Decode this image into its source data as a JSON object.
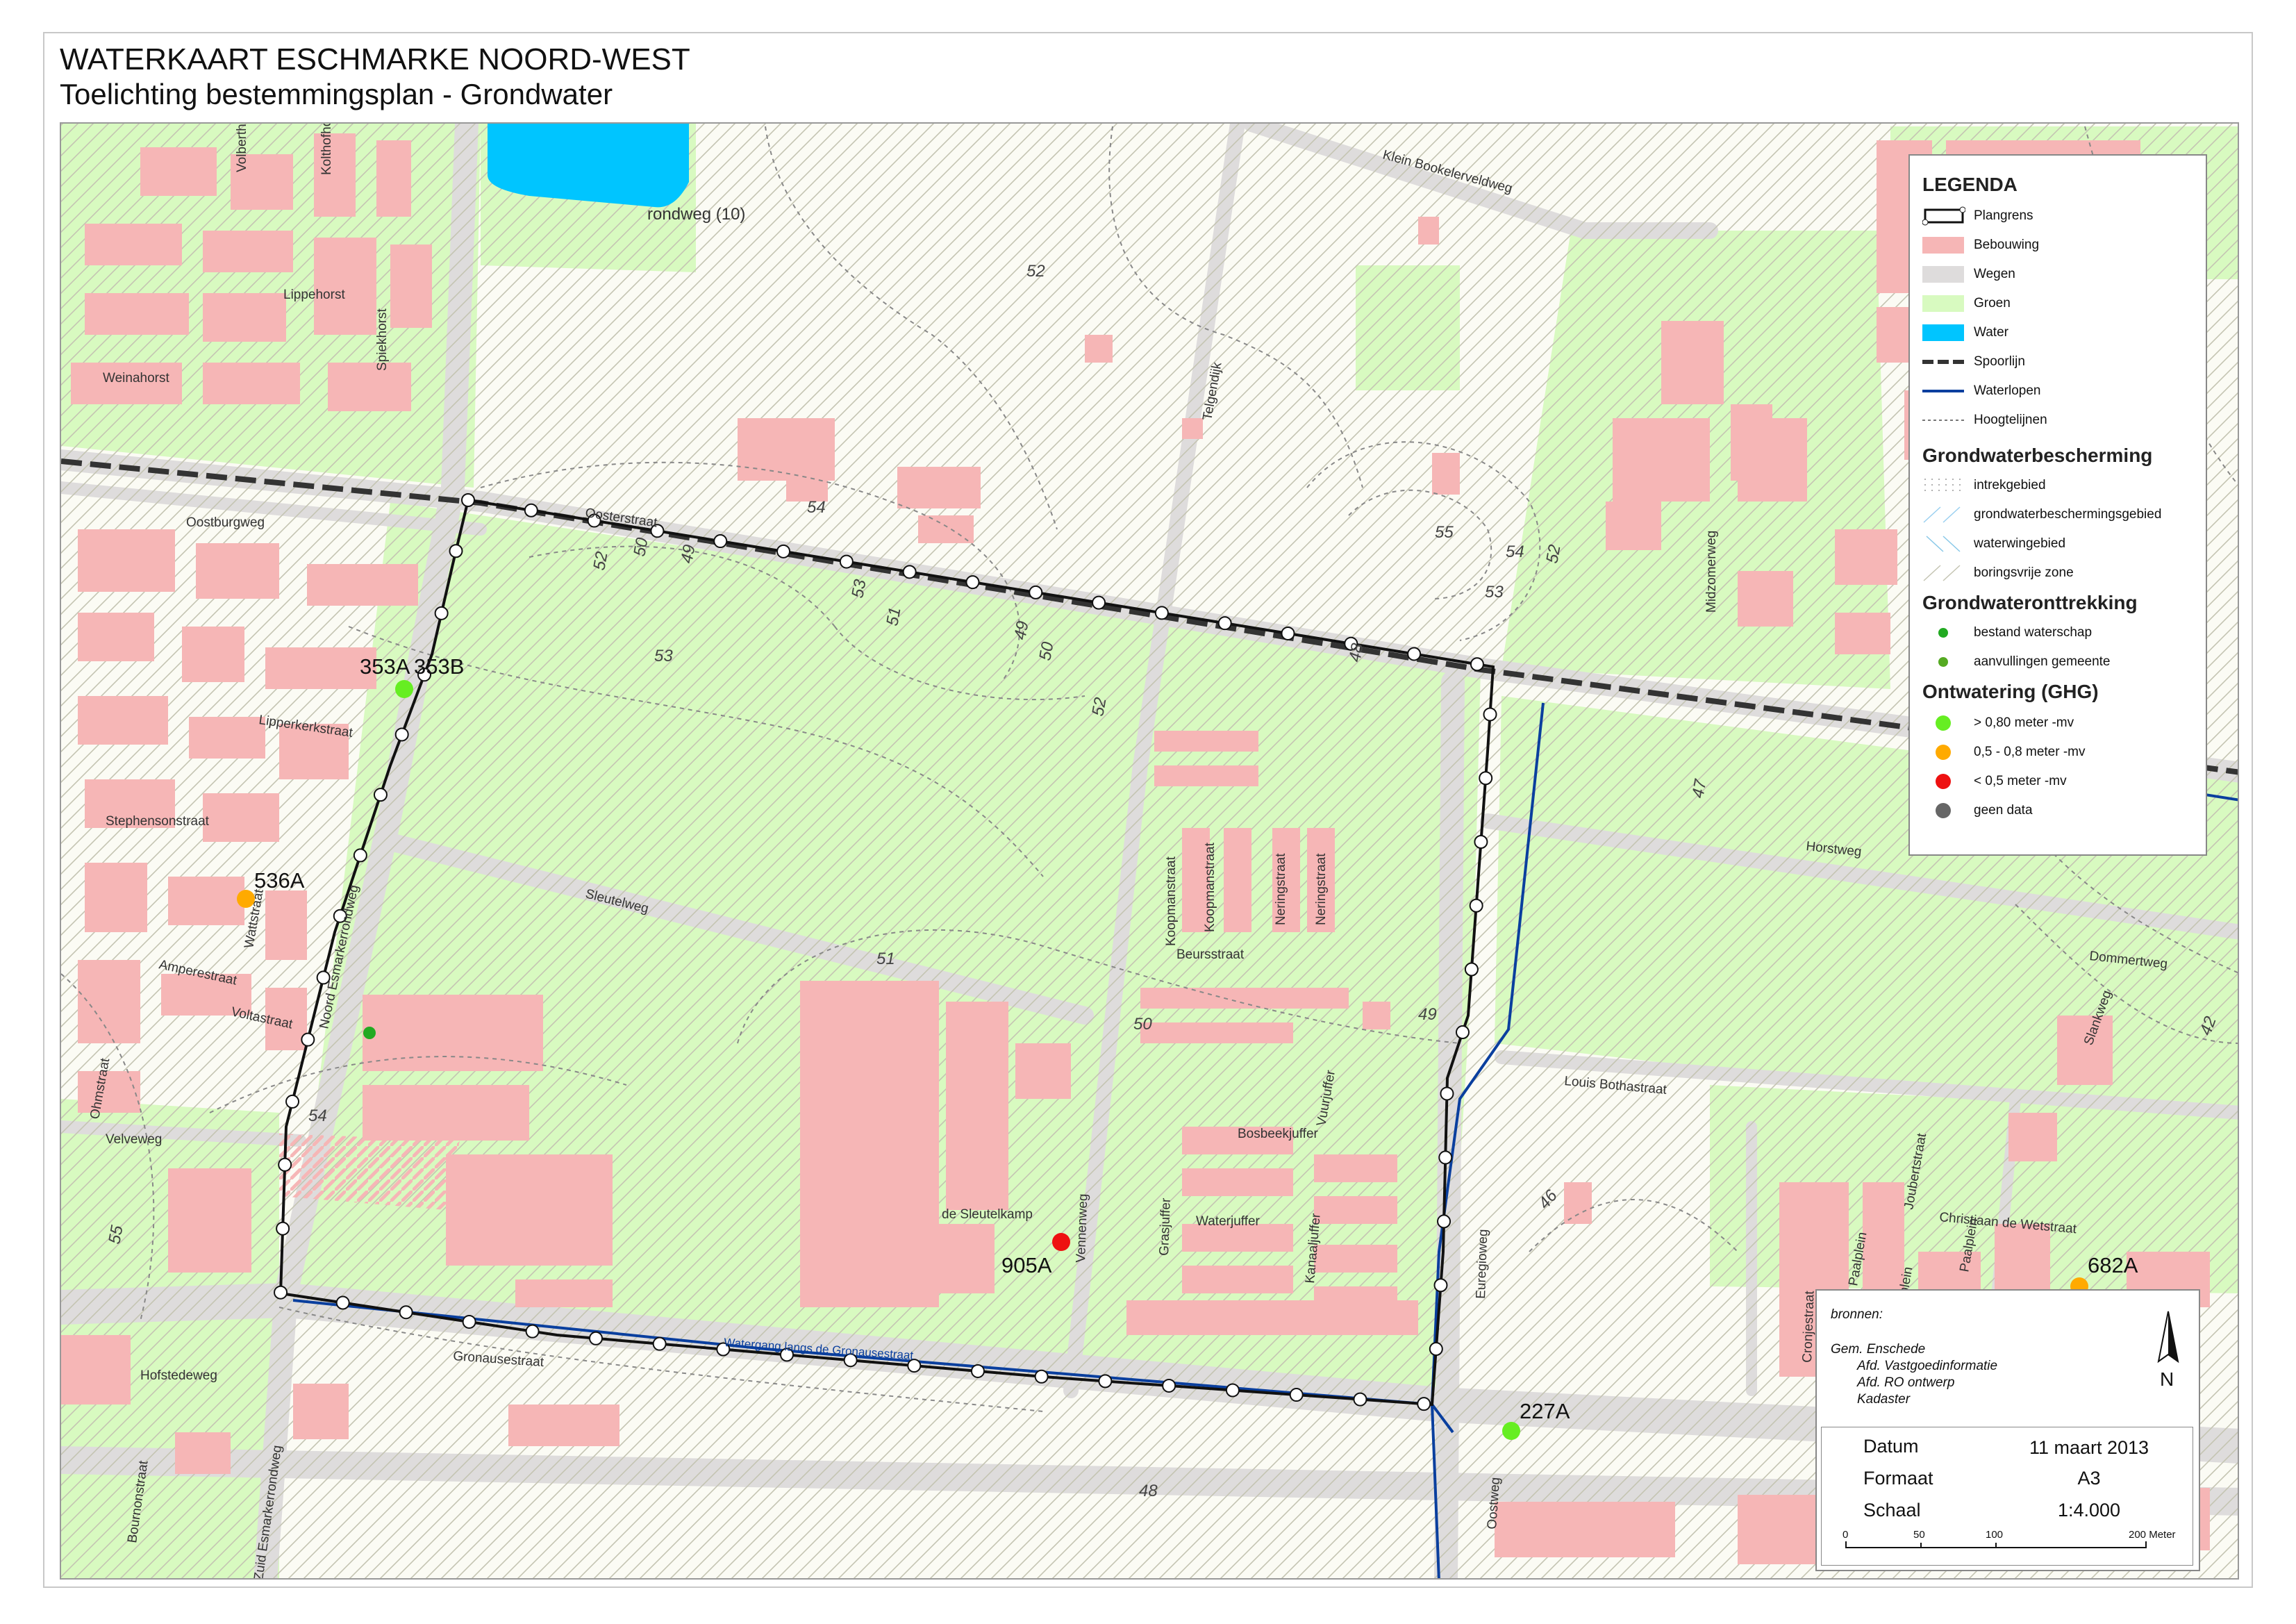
{
  "header": {
    "title": "WATERKAART ESCHMARKE NOORD-WEST",
    "subtitle": "Toelichting bestemmingsplan - Grondwater"
  },
  "colors": {
    "bebouwing": "#f6b6b6",
    "wegen": "#dedcdc",
    "groen": "#d8fac0",
    "water": "#00c5ff",
    "waterlopen": "#0a3f9e",
    "spoorlijn": "#333333",
    "hatch": "#c8c8b8",
    "well_green": "#66ee22",
    "well_orange": "#ffaa00",
    "well_red": "#ee1111",
    "well_grey": "#666666",
    "dot_waterschap": "#22aa22",
    "dot_gemeente": "#55aa22"
  },
  "map": {
    "place_labels": {
      "rondweg": "rondweg (10)",
      "waterloop_label": "Watergang langs de Gronausestraat"
    },
    "streets": [
      {
        "id": "volberthorst",
        "text": "Volberthorst"
      },
      {
        "id": "kolthofhorst",
        "text": "Kolthofhorst"
      },
      {
        "id": "lippehorst",
        "text": "Lippehorst"
      },
      {
        "id": "spiekhorst",
        "text": "Spiekhorst"
      },
      {
        "id": "weinahorst",
        "text": "Weinahorst"
      },
      {
        "id": "oostburgweg",
        "text": "Oostburgweg"
      },
      {
        "id": "oosterstraat",
        "text": "Oosterstraat"
      },
      {
        "id": "klein-bookelerveldweg",
        "text": "Klein Bookelerveldweg"
      },
      {
        "id": "telgendijk",
        "text": "Telgendijk"
      },
      {
        "id": "lipperkerkstraat",
        "text": "Lipperkerkstraat"
      },
      {
        "id": "stephensonstraat",
        "text": "Stephensonstraat"
      },
      {
        "id": "wattstraat",
        "text": "Wattstraat"
      },
      {
        "id": "amperestraat",
        "text": "Amperestraat"
      },
      {
        "id": "voltastraat",
        "text": "Voltastraat"
      },
      {
        "id": "noord-esmarkerrondweg",
        "text": "Noord Esmarkerrondweg"
      },
      {
        "id": "ohmstraat",
        "text": "Ohmstraat"
      },
      {
        "id": "velveweg",
        "text": "Velveweg"
      },
      {
        "id": "sleutelweg",
        "text": "Sleutelweg"
      },
      {
        "id": "koopmanstraat-1",
        "text": "Koopmanstraat"
      },
      {
        "id": "koopmanstraat-2",
        "text": "Koopmanstraat"
      },
      {
        "id": "neringstraat-1",
        "text": "Neringstraat"
      },
      {
        "id": "neringstraat-2",
        "text": "Neringstraat"
      },
      {
        "id": "beursstraat",
        "text": "Beursstraat"
      },
      {
        "id": "de-sleutelkamp",
        "text": "de Sleutelkamp"
      },
      {
        "id": "vennenweg",
        "text": "Vennenweg"
      },
      {
        "id": "grasjuffer",
        "text": "Grasjuffer"
      },
      {
        "id": "waterjuffer",
        "text": "Waterjuffer"
      },
      {
        "id": "bosbeekjuffer",
        "text": "Bosbeekjuffer"
      },
      {
        "id": "vuurjuffer",
        "text": "Vuurjuffer"
      },
      {
        "id": "kanaaljuffer",
        "text": "Kanaaljuffer"
      },
      {
        "id": "gronausestraat",
        "text": "Gronausestraat"
      },
      {
        "id": "hofstedeweg",
        "text": "Hofstedeweg"
      },
      {
        "id": "zuid-esmarkerrondweg",
        "text": "Zuid Esmarkerrondweg"
      },
      {
        "id": "bournonstraat",
        "text": "Bournonstraat"
      },
      {
        "id": "midzomerweg",
        "text": "Midzomerweg"
      },
      {
        "id": "horstweg",
        "text": "Horstweg"
      },
      {
        "id": "dommertweg",
        "text": "Dommertweg"
      },
      {
        "id": "slankweg",
        "text": "Slankweg"
      },
      {
        "id": "louis-bothastraat",
        "text": "Louis Bothastraat"
      },
      {
        "id": "euregioweg",
        "text": "Euregioweg"
      },
      {
        "id": "oostweg",
        "text": "Oostweg"
      },
      {
        "id": "christiaan-de-wetstraat",
        "text": "Christiaan de Wetstraat"
      },
      {
        "id": "joubertstraat",
        "text": "Joubertstraat"
      },
      {
        "id": "cronjestraat",
        "text": "Cronjestraat"
      },
      {
        "id": "paalplein-1",
        "text": "Paalplein"
      },
      {
        "id": "paalplein-2",
        "text": "Paalplein"
      },
      {
        "id": "paalplein-3",
        "text": "Paalplein"
      }
    ],
    "contour_labels": [
      {
        "id": "c52-top",
        "text": "52"
      },
      {
        "id": "c54-a",
        "text": "54"
      },
      {
        "id": "c52-b",
        "text": "52"
      },
      {
        "id": "c50-a",
        "text": "50"
      },
      {
        "id": "c49-a",
        "text": "49"
      },
      {
        "id": "c53-a",
        "text": "53"
      },
      {
        "id": "c53-b",
        "text": "53"
      },
      {
        "id": "c51-a",
        "text": "51"
      },
      {
        "id": "c49-b",
        "text": "49"
      },
      {
        "id": "c50-b",
        "text": "50"
      },
      {
        "id": "c52-c",
        "text": "52"
      },
      {
        "id": "c48-a",
        "text": "48"
      },
      {
        "id": "c55-a",
        "text": "55"
      },
      {
        "id": "c54-b",
        "text": "54"
      },
      {
        "id": "c52-d",
        "text": "52"
      },
      {
        "id": "c53-c",
        "text": "53"
      },
      {
        "id": "c47",
        "text": "47"
      },
      {
        "id": "c51-b",
        "text": "51"
      },
      {
        "id": "c50-c",
        "text": "50"
      },
      {
        "id": "c49-c",
        "text": "49"
      },
      {
        "id": "c54-c",
        "text": "54"
      },
      {
        "id": "c55-b",
        "text": "55"
      },
      {
        "id": "c46",
        "text": "46"
      },
      {
        "id": "c48-b",
        "text": "48"
      },
      {
        "id": "c42",
        "text": "42"
      }
    ],
    "wells": [
      {
        "id": "353A",
        "text": "353A",
        "class": "green"
      },
      {
        "id": "353B",
        "text": "353B",
        "class": "none"
      },
      {
        "id": "536A",
        "text": "536A",
        "class": "orange"
      },
      {
        "id": "905A",
        "text": "905A",
        "class": "red"
      },
      {
        "id": "227A",
        "text": "227A",
        "class": "green"
      },
      {
        "id": "682A",
        "text": "682A",
        "class": "orange"
      }
    ]
  },
  "legend": {
    "title": "LEGENDA",
    "items_basis": [
      {
        "label": "Plangrens",
        "symbol": "plangrens"
      },
      {
        "label": "Bebouwing",
        "symbol": "bebouwing"
      },
      {
        "label": "Wegen",
        "symbol": "wegen"
      },
      {
        "label": "Groen",
        "symbol": "groen"
      },
      {
        "label": "Water",
        "symbol": "water"
      },
      {
        "label": "Spoorlijn",
        "symbol": "spoorlijn"
      },
      {
        "label": "Waterlopen",
        "symbol": "waterlopen"
      },
      {
        "label": "Hoogtelijnen",
        "symbol": "hoogtelijnen"
      }
    ],
    "section_bescherming": "Grondwaterbescherming",
    "items_bescherming": [
      {
        "label": "intrekgebied",
        "symbol": "dots"
      },
      {
        "label": "grondwaterbeschermingsgebied",
        "symbol": "hatch-blue"
      },
      {
        "label": "waterwingebied",
        "symbol": "hatch-cyan"
      },
      {
        "label": "boringsvrije zone",
        "symbol": "hatch-grey"
      }
    ],
    "section_onttrekking": "Grondwateronttrekking",
    "items_onttrekking": [
      {
        "label": "bestand waterschap",
        "symbol": "dot-waterschap"
      },
      {
        "label": "aanvullingen gemeente",
        "symbol": "dot-gemeente"
      }
    ],
    "section_ontwatering": "Ontwatering (GHG)",
    "items_ontwatering": [
      {
        "label": "> 0,80 meter -mv",
        "symbol": "well-green"
      },
      {
        "label": "0,5 - 0,8 meter -mv",
        "symbol": "well-orange"
      },
      {
        "label": "< 0,5 meter -mv",
        "symbol": "well-red"
      },
      {
        "label": "geen data",
        "symbol": "well-grey"
      }
    ]
  },
  "sources": {
    "heading": "bronnen:",
    "lines": [
      "Gem. Enschede",
      "Afd. Vastgoedinformatie",
      "Afd. RO ontwerp",
      "Kadaster"
    ],
    "north": "N",
    "datum_label": "Datum",
    "datum_value": "11 maart 2013",
    "formaat_label": "Formaat",
    "formaat_value": "A3",
    "schaal_label": "Schaal",
    "schaal_value": "1:4.000",
    "scalebar": [
      "0",
      "50",
      "100",
      "200 Meter"
    ]
  }
}
